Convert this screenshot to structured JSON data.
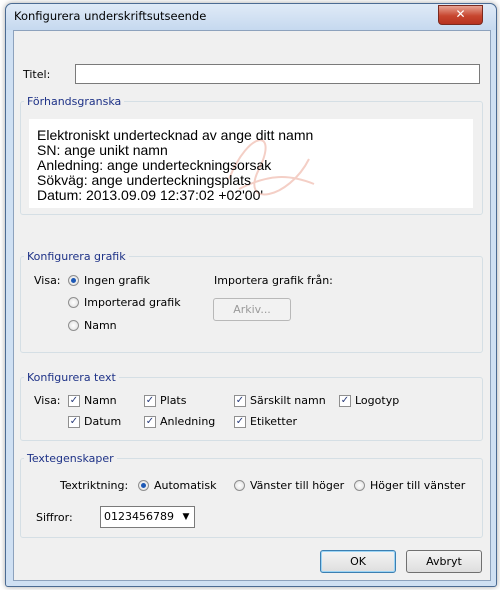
{
  "window": {
    "title": "Konfigurera underskriftsutseende",
    "close_glyph": "✕"
  },
  "title_field": {
    "label": "Titel:",
    "value": ""
  },
  "preview": {
    "legend": "Förhandsgranska",
    "lines": [
      "Elektroniskt undertecknad av ange ditt namn",
      "SN: ange unikt namn",
      "Anledning: ange underteckningsorsak",
      "Sökväg: ange underteckningsplats",
      "Datum: 2013.09.09 12:37:02 +02'00'"
    ]
  },
  "graphics": {
    "legend": "Konfigurera grafik",
    "show_label": "Visa:",
    "options": [
      "Ingen grafik",
      "Importerad grafik",
      "Namn"
    ],
    "selected": "Ingen grafik",
    "import_label": "Importera grafik från:",
    "file_button": "Arkiv..."
  },
  "text": {
    "legend": "Konfigurera text",
    "show_label": "Visa:",
    "items": [
      "Namn",
      "Plats",
      "Särskilt namn",
      "Logotyp",
      "Datum",
      "Anledning",
      "Etiketter"
    ],
    "checked": true
  },
  "text_props": {
    "legend": "Textegenskaper",
    "direction_label": "Textriktning:",
    "direction_options": [
      "Automatisk",
      "Vänster till höger",
      "Höger till vänster"
    ],
    "direction_selected": "Automatisk",
    "digits_label": "Siffror:",
    "digits_value": "0123456789"
  },
  "buttons": {
    "ok": "OK",
    "cancel": "Avbryt"
  },
  "icons": {
    "close": "close-icon",
    "dropdown": "chevron-down-icon",
    "check": "check-icon"
  },
  "colors": {
    "accent": "#1c58b5",
    "legend_text": "#1e3287"
  }
}
